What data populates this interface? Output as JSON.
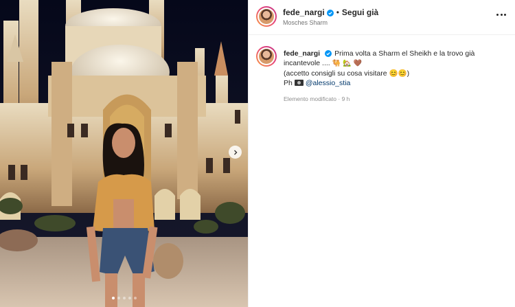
{
  "post": {
    "carousel": {
      "slides": 5,
      "active_index": 0,
      "next_icon": "chevron-right-icon"
    },
    "author": {
      "username": "fede_nargi",
      "verified": true
    },
    "header": {
      "separator": "•",
      "follow_label": "Segui già",
      "location": "Mosches Sharm",
      "more_icon": "more-horizontal-icon"
    },
    "caption": {
      "line1": "Prima volta a Sharm el Sheikh e la trovo già incantevole ....",
      "line1_emojis": "🐫 🏡 🤎",
      "line2": "(accetto consigli su cosa visitare 😊😊)",
      "credit_prefix": "Ph",
      "credit_icon": "camera-icon",
      "mention": "@alessio_stia",
      "meta": "Elemento modificato · 9 h"
    },
    "colors": {
      "link": "#00376b",
      "verified": "#0095f6",
      "muted": "#737373"
    }
  }
}
